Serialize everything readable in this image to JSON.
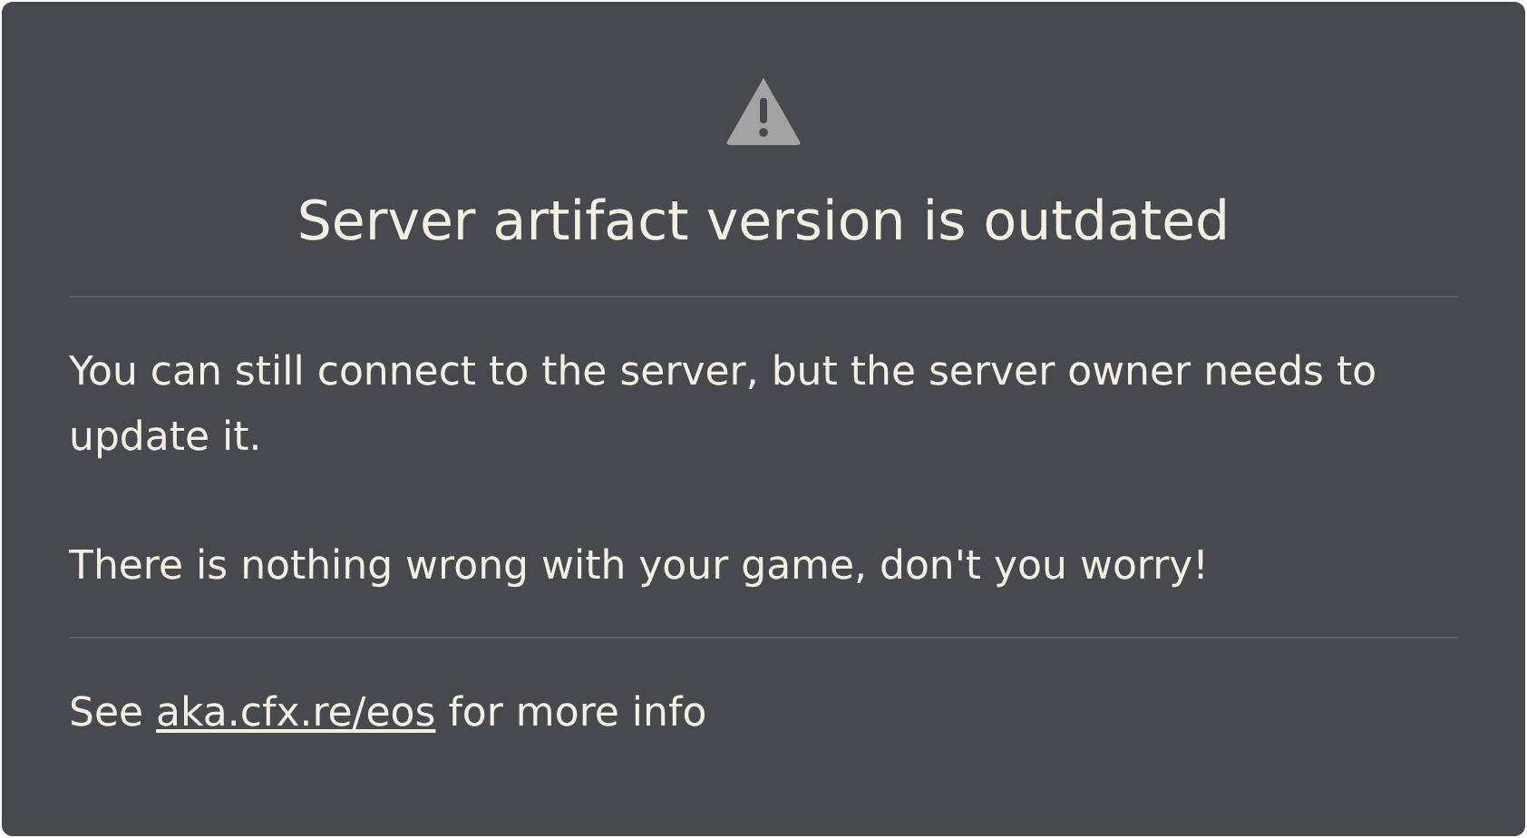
{
  "dialog": {
    "title": "Server artifact version is outdated",
    "paragraphs": [
      "You can still connect to the server, but the server owner needs to update it.",
      "There is nothing wrong with your game, don't you worry!"
    ],
    "footer": {
      "before": "See",
      "link": "aka.cfx.re/eos",
      "after": "for more info"
    }
  }
}
